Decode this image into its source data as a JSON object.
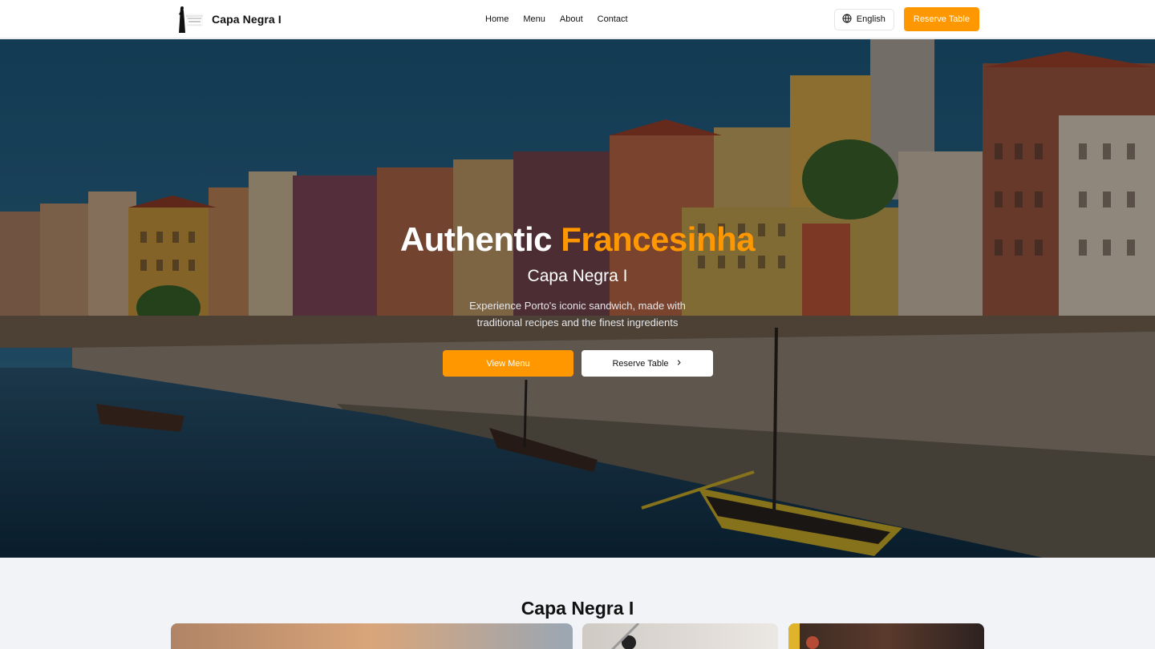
{
  "header": {
    "brand_name": "Capa Negra I",
    "nav": [
      {
        "label": "Home"
      },
      {
        "label": "Menu"
      },
      {
        "label": "About"
      },
      {
        "label": "Contact"
      }
    ],
    "language_label": "English",
    "reserve_label": "Reserve Table"
  },
  "hero": {
    "title_part1": "Authentic",
    "title_part2": "Francesinha",
    "subtitle": "Capa Negra I",
    "description": "Experience Porto's iconic sandwich, made with traditional recipes and the finest ingredients",
    "primary_button": "View Menu",
    "secondary_button": "Reserve Table"
  },
  "section": {
    "title": "Capa Negra I"
  },
  "colors": {
    "accent": "#ff9800",
    "header_bg": "#ffffff",
    "section_bg": "#f1f3f7"
  }
}
